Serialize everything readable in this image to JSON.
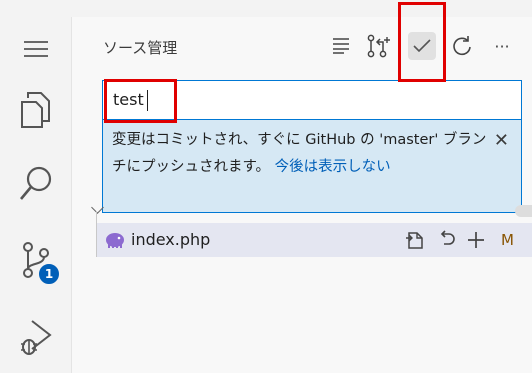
{
  "sidebar": {
    "title": "ソース管理"
  },
  "activity_bar": {
    "items": [
      {
        "icon": "menu-icon"
      },
      {
        "icon": "explorer-icon"
      },
      {
        "icon": "search-icon"
      },
      {
        "icon": "source-control-icon",
        "badge": "1"
      },
      {
        "icon": "run-debug-icon"
      }
    ]
  },
  "toolbar": {
    "icons": [
      "view-as-list-icon",
      "pull-request-icon",
      "commit-check-icon",
      "refresh-icon",
      "more-actions-icon"
    ],
    "more_label": "···"
  },
  "commit": {
    "message": "test"
  },
  "notification": {
    "text": "変更はコミットされ、すぐに GitHub の 'master' ブランチにプッシュされます。",
    "link": "今後は表示しない",
    "close": "✕"
  },
  "changes": [
    {
      "file": "index.php",
      "status": "M",
      "icon": "php-file-icon",
      "actions": [
        "open-file-icon",
        "discard-changes-icon",
        "stage-changes-icon"
      ]
    }
  ],
  "colors": {
    "accent": "#005fb8",
    "highlight": "#e00000",
    "modified": "#895503"
  }
}
